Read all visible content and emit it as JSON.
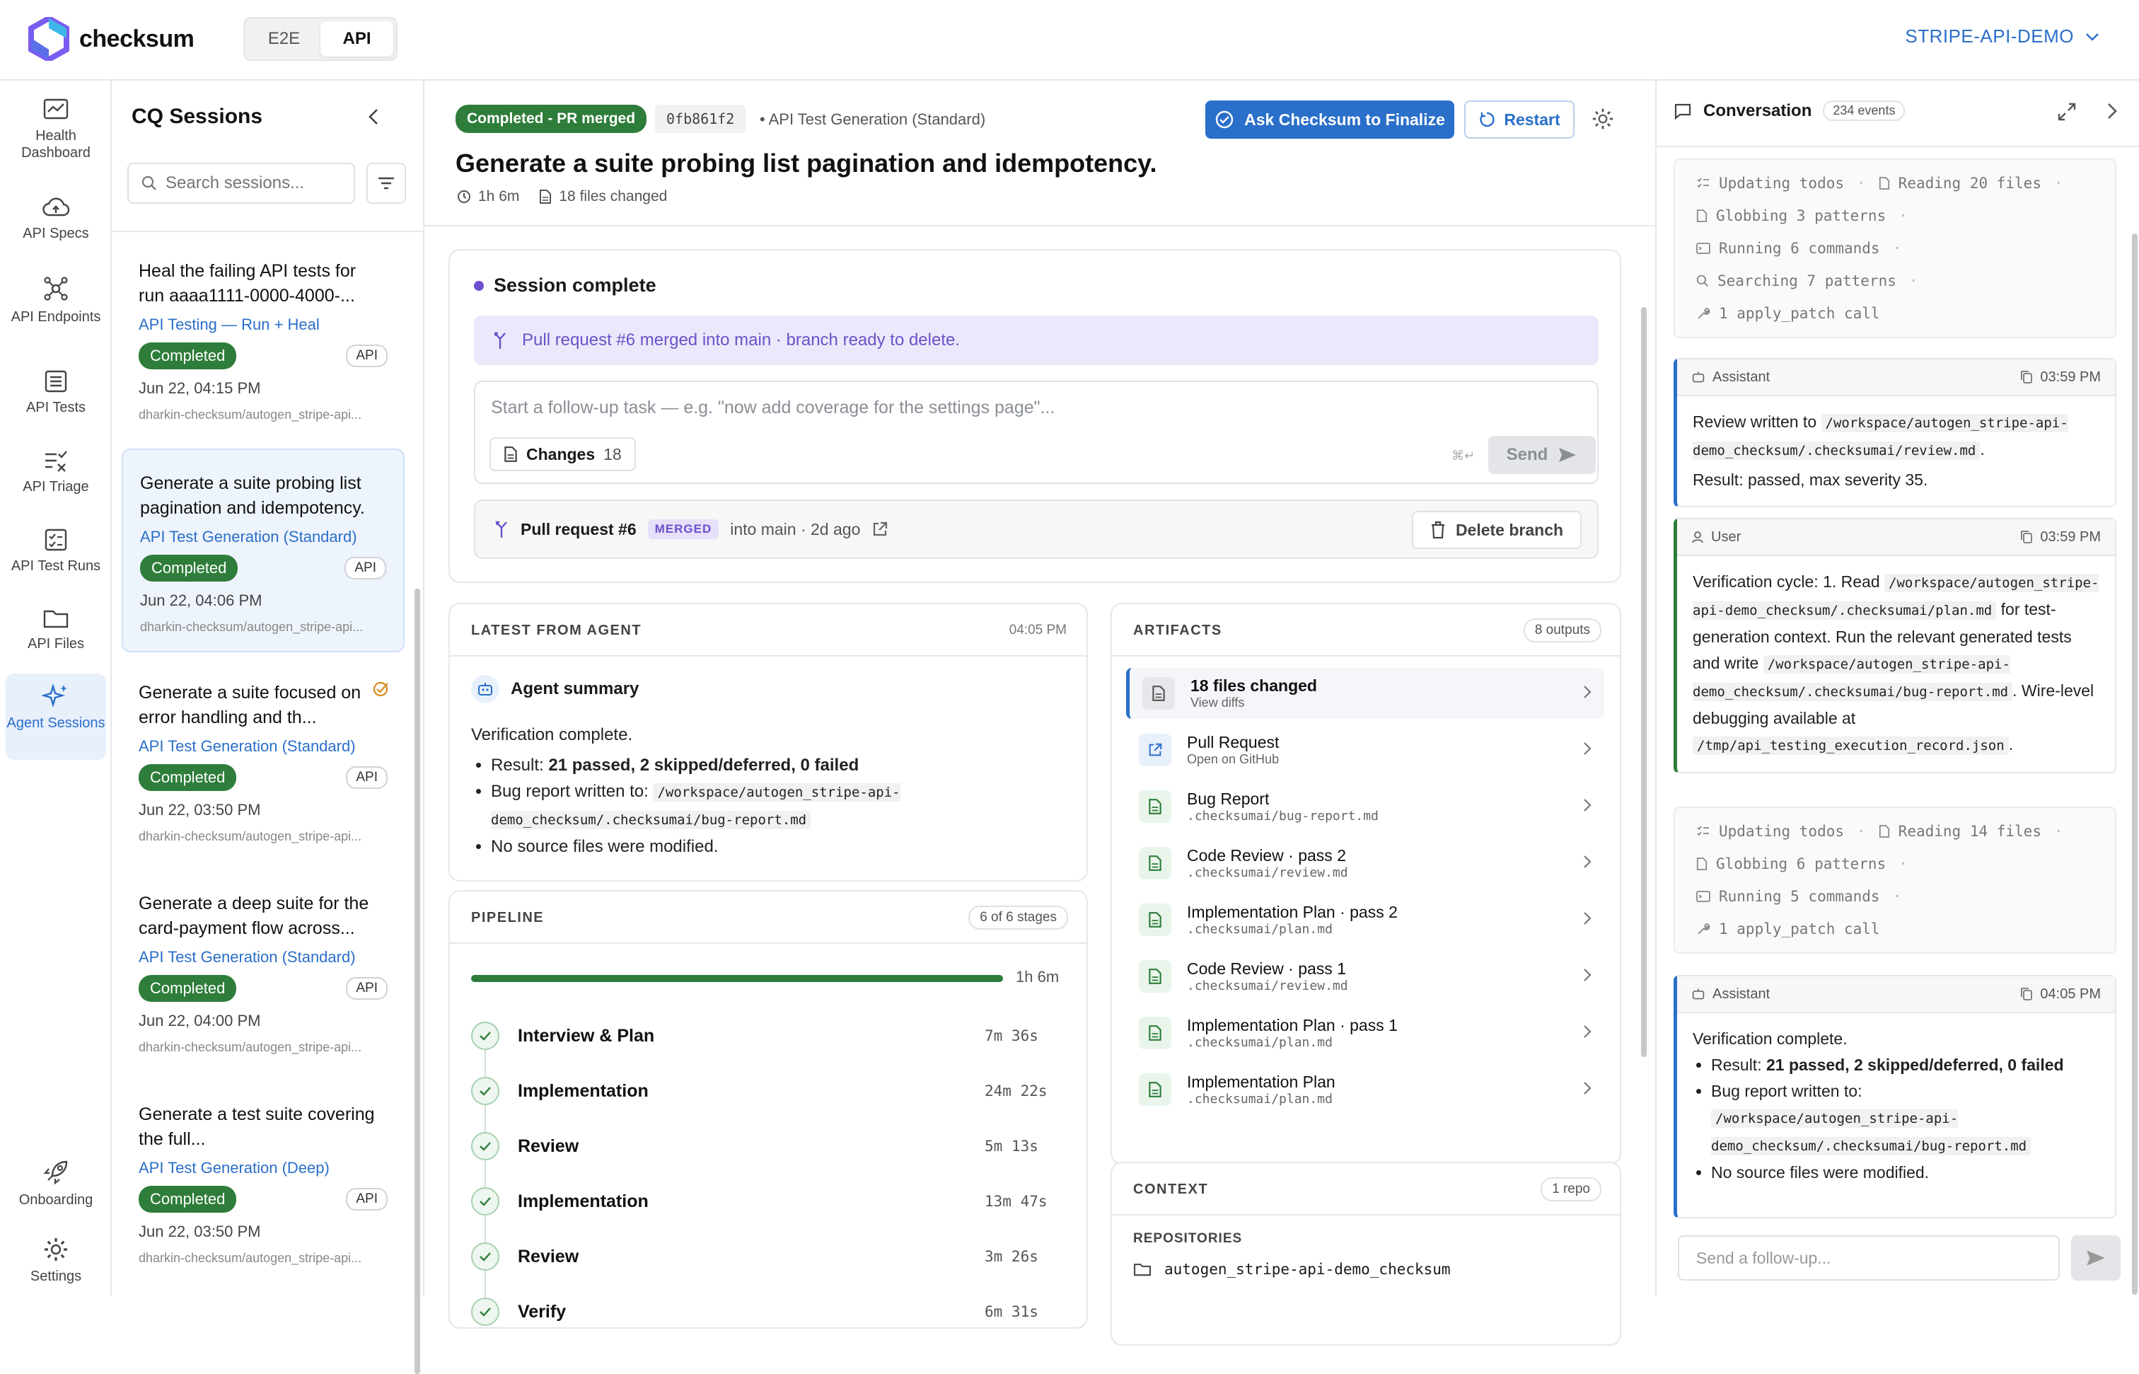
{
  "brand": {
    "name": "checksum"
  },
  "mode_tabs": [
    {
      "label": "E2E"
    },
    {
      "label": "API"
    }
  ],
  "project": {
    "name": "STRIPE-API-DEMO"
  },
  "nav": [
    {
      "label": "Health Dashboard"
    },
    {
      "label": "API Specs"
    },
    {
      "label": "API Endpoints"
    },
    {
      "label": "API Tests"
    },
    {
      "label": "API Triage"
    },
    {
      "label": "API Test Runs"
    },
    {
      "label": "API Files"
    },
    {
      "label": "Agent Sessions"
    },
    {
      "label": "Onboarding"
    },
    {
      "label": "Settings"
    }
  ],
  "sessions": {
    "title": "CQ Sessions",
    "search_placeholder": "Search sessions...",
    "items": [
      {
        "title": "Heal the failing API tests for run aaaa1111-0000-4000-...",
        "type": "API Testing — Run + Heal",
        "status": "Completed",
        "tag": "API",
        "date": "Jun 22, 04:15 PM",
        "branch": "dharkin-checksum/autogen_stripe-api..."
      },
      {
        "title": "Generate a suite probing list pagination and idempotency.",
        "type": "API Test Generation (Standard)",
        "status": "Completed",
        "tag": "API",
        "date": "Jun 22, 04:06 PM",
        "branch": "dharkin-checksum/autogen_stripe-api..."
      },
      {
        "title": "Generate a suite focused on error handling and th...",
        "type": "API Test Generation (Standard)",
        "status": "Completed",
        "tag": "API",
        "date": "Jun 22, 03:50 PM",
        "branch": "dharkin-checksum/autogen_stripe-api..."
      },
      {
        "title": "Generate a deep suite for the card-payment flow across...",
        "type": "API Test Generation (Standard)",
        "status": "Completed",
        "tag": "API",
        "date": "Jun 22, 04:00 PM",
        "branch": "dharkin-checksum/autogen_stripe-api..."
      },
      {
        "title": "Generate a test suite covering the full...",
        "type": "API Test Generation (Deep)",
        "status": "Completed",
        "tag": "API",
        "date": "Jun 22, 03:50 PM",
        "branch": "dharkin-checksum/autogen_stripe-api..."
      }
    ]
  },
  "session": {
    "status": "Completed - PR merged",
    "hash": "0fb861f2",
    "type": "API Test Generation (Standard)",
    "title": "Generate a suite probing list pagination and idempotency.",
    "duration": "1h 6m",
    "files_changed": "18 files changed",
    "finalize_label": "Ask Checksum to Finalize",
    "restart_label": "Restart"
  },
  "complete": {
    "title": "Session complete",
    "merged_msg": "Pull request #6 merged into main · branch ready to delete.",
    "followup_placeholder": "Start a follow-up task — e.g. \"now add coverage for the settings page\"...",
    "changes_label": "Changes",
    "changes_count": "18",
    "send_hint": "⌘↵",
    "send_label": "Send",
    "pr_label": "Pull request #6",
    "pr_tag": "MERGED",
    "pr_sub": "into main · 2d ago",
    "delete_label": "Delete branch"
  },
  "latest": {
    "heading": "LATEST FROM AGENT",
    "time": "04:05 PM",
    "summary_title": "Agent summary",
    "line1": "Verification complete.",
    "b1_pre": "Result: ",
    "b1_bold": "21 passed, 2 skipped/deferred, 0 failed",
    "b2_pre": "Bug report written to: ",
    "b2_code": "/workspace/autogen_stripe-api-demo_checksum/.checksumai/bug-report.md",
    "b3": "No source files were modified."
  },
  "pipeline": {
    "heading": "PIPELINE",
    "count": "6 of 6 stages",
    "total": "1h 6m",
    "progress": 1.0,
    "stages": [
      {
        "name": "Interview & Plan",
        "time": "7m 36s"
      },
      {
        "name": "Implementation",
        "time": "24m 22s"
      },
      {
        "name": "Review",
        "time": "5m 13s"
      },
      {
        "name": "Implementation",
        "time": "13m 47s"
      },
      {
        "name": "Review",
        "time": "3m 26s"
      },
      {
        "name": "Verify",
        "time": "6m 31s"
      }
    ]
  },
  "artifacts": {
    "heading": "ARTIFACTS",
    "count": "8 outputs",
    "items": [
      {
        "title": "18 files changed",
        "sub": "View diffs"
      },
      {
        "title": "Pull Request",
        "sub": "Open on GitHub"
      },
      {
        "title": "Bug Report",
        "sub": ".checksumai/bug-report.md"
      },
      {
        "title": "Code Review · pass 2",
        "sub": ".checksumai/review.md"
      },
      {
        "title": "Implementation Plan · pass 2",
        "sub": ".checksumai/plan.md"
      },
      {
        "title": "Code Review · pass 1",
        "sub": ".checksumai/review.md"
      },
      {
        "title": "Implementation Plan · pass 1",
        "sub": ".checksumai/plan.md"
      },
      {
        "title": "Implementation Plan",
        "sub": ".checksumai/plan.md"
      }
    ]
  },
  "context": {
    "heading": "CONTEXT",
    "count": "1 repo",
    "repos_label": "REPOSITORIES",
    "repo": "autogen_stripe-api-demo_checksum"
  },
  "conversation": {
    "title": "Conversation",
    "events": "234 events",
    "tools1": [
      "Updating todos",
      "Reading 20 files",
      "Globbing 3 patterns",
      "Running 6 commands",
      "Searching 7 patterns",
      "1 apply_patch call"
    ],
    "msg1": {
      "role": "Assistant",
      "time": "03:59 PM",
      "pre": "Review written to ",
      "code": "/workspace/autogen_stripe-api-demo_checksum/.checksumai/review.md",
      "post": ".",
      "line2": "Result: passed, max severity 35."
    },
    "msg2": {
      "role": "User",
      "time": "03:59 PM",
      "t1": "Verification cycle: 1. Read ",
      "c1": "/workspace/autogen_stripe-api-demo_checksum/.checksumai/plan.md",
      "t2": " for test-generation context. Run the relevant generated tests and write ",
      "c2": "/workspace/autogen_stripe-api-demo_checksum/.checksumai/bug-report.md",
      "t3": ". Wire-level debugging available at ",
      "c3": "/tmp/api_testing_execution_record.json",
      "t4": "."
    },
    "tools2": [
      "Updating todos",
      "Reading 14 files",
      "Globbing 6 patterns",
      "Running 5 commands",
      "1 apply_patch call"
    ],
    "msg3": {
      "role": "Assistant",
      "time": "04:05 PM",
      "line1": "Verification complete.",
      "b1_pre": "Result: ",
      "b1_bold": "21 passed, 2 skipped/deferred, 0 failed",
      "b2": "Bug report written to:",
      "b2_code": "/workspace/autogen_stripe-api-demo_checksum/.checksumai/bug-report.md",
      "b3": "No source files were modified."
    },
    "input_placeholder": "Send a follow-up..."
  }
}
